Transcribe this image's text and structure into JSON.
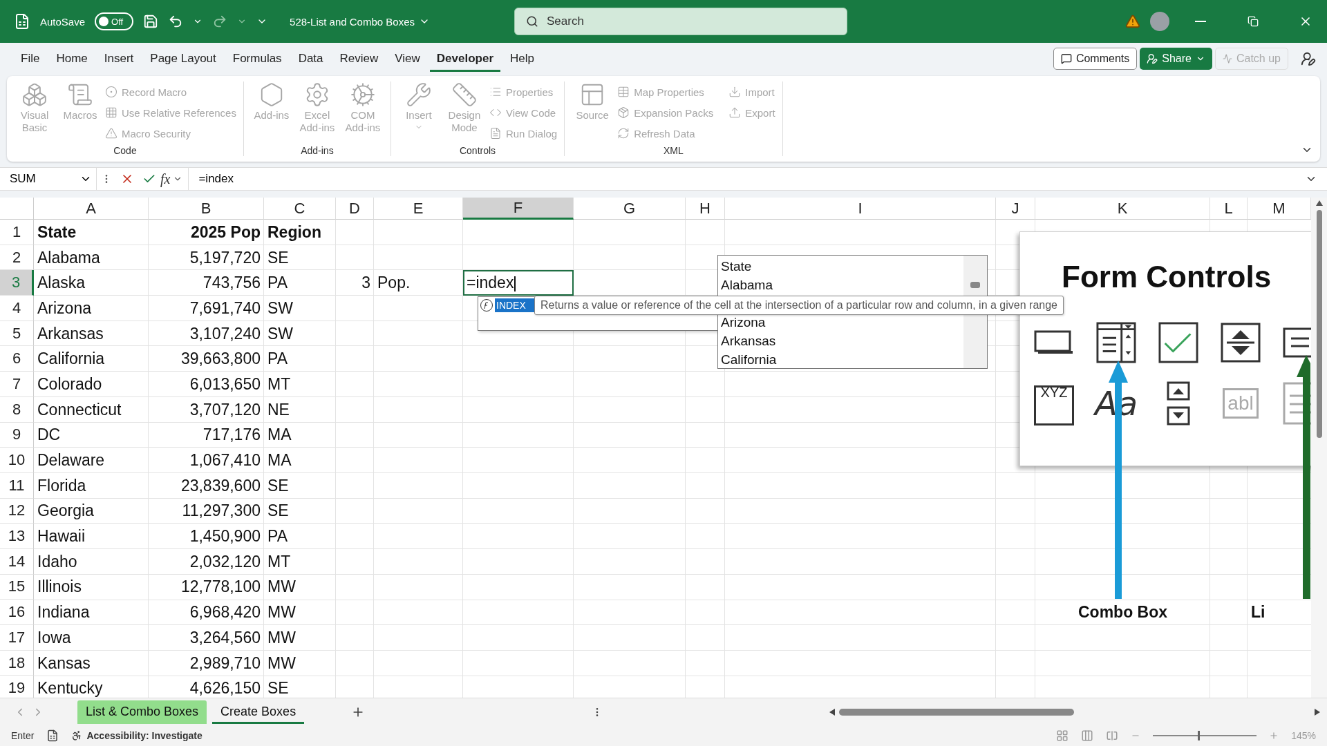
{
  "title_bar": {
    "autosave_label": "AutoSave",
    "autosave_on": false,
    "autosave_state": "Off",
    "file_name": "528-List and Combo Boxes",
    "search_placeholder": "Search"
  },
  "menu_tabs": [
    {
      "label": "File",
      "selected": false
    },
    {
      "label": "Home",
      "selected": false
    },
    {
      "label": "Insert",
      "selected": false
    },
    {
      "label": "Page Layout",
      "selected": false
    },
    {
      "label": "Formulas",
      "selected": false
    },
    {
      "label": "Data",
      "selected": false
    },
    {
      "label": "Review",
      "selected": false
    },
    {
      "label": "View",
      "selected": false
    },
    {
      "label": "Developer",
      "selected": true
    },
    {
      "label": "Help",
      "selected": false
    }
  ],
  "header_buttons": {
    "comments": "Comments",
    "share": "Share",
    "catch_up": "Catch up"
  },
  "ribbon_groups": [
    {
      "label": "Code",
      "items": [
        {
          "kind": "large",
          "label": "Visual Basic",
          "disabled": true
        },
        {
          "kind": "large",
          "label": "Macros",
          "disabled": true
        },
        {
          "kind": "small",
          "label": "Record Macro",
          "disabled": true
        },
        {
          "kind": "small",
          "label": "Use Relative References",
          "disabled": true
        },
        {
          "kind": "small",
          "label": "Macro Security",
          "disabled": true
        }
      ]
    },
    {
      "label": "Add-ins",
      "items": [
        {
          "kind": "large",
          "label": "Add-ins",
          "disabled": true
        },
        {
          "kind": "large",
          "label": "Excel Add-ins",
          "disabled": true
        },
        {
          "kind": "large",
          "label": "COM Add-ins",
          "disabled": true
        }
      ]
    },
    {
      "label": "Controls",
      "items": [
        {
          "kind": "large",
          "label": "Insert",
          "disabled": true,
          "dropdown": true
        },
        {
          "kind": "large",
          "label": "Design Mode",
          "disabled": true
        },
        {
          "kind": "small",
          "label": "Properties",
          "disabled": true
        },
        {
          "kind": "small",
          "label": "View Code",
          "disabled": true
        },
        {
          "kind": "small",
          "label": "Run Dialog",
          "disabled": true
        }
      ]
    },
    {
      "label": "XML",
      "items": [
        {
          "kind": "large",
          "label": "Source",
          "disabled": true
        },
        {
          "kind": "small",
          "label": "Map Properties",
          "disabled": true
        },
        {
          "kind": "small",
          "label": "Expansion Packs",
          "disabled": true
        },
        {
          "kind": "small",
          "label": "Refresh Data",
          "disabled": true
        },
        {
          "kind": "small",
          "label": "Import",
          "disabled": true
        },
        {
          "kind": "small",
          "label": "Export",
          "disabled": true
        }
      ]
    }
  ],
  "formula_bar": {
    "name_box": "SUM",
    "function_label": "fx",
    "formula": "=index"
  },
  "columns": [
    {
      "label": "A",
      "selected": false
    },
    {
      "label": "B",
      "selected": false
    },
    {
      "label": "C",
      "selected": false
    },
    {
      "label": "D",
      "selected": false
    },
    {
      "label": "E",
      "selected": false
    },
    {
      "label": "F",
      "selected": true
    },
    {
      "label": "G",
      "selected": false
    },
    {
      "label": "H",
      "selected": false
    },
    {
      "label": "I",
      "selected": false
    },
    {
      "label": "J",
      "selected": false
    },
    {
      "label": "K",
      "selected": false
    },
    {
      "label": "L",
      "selected": false
    },
    {
      "label": "M",
      "selected": false
    }
  ],
  "rows": [
    {
      "number": "1",
      "selected": false,
      "cells": [
        {
          "text": "State",
          "bold": true
        },
        {
          "text": "2025 Pop",
          "bold": true
        },
        {
          "text": "Region",
          "bold": true
        }
      ]
    },
    {
      "number": "2",
      "selected": false,
      "cells": [
        "Alabama",
        "5,197,720",
        "SE"
      ]
    },
    {
      "number": "3",
      "selected": true,
      "cells": [
        "Alaska",
        "743,756",
        "PA",
        "3",
        "Pop.",
        {
          "text": "=index",
          "editing": true
        }
      ]
    },
    {
      "number": "4",
      "selected": false,
      "cells": [
        "Arizona",
        "7,691,740",
        "SW"
      ]
    },
    {
      "number": "5",
      "selected": false,
      "cells": [
        "Arkansas",
        "3,107,240",
        "SW"
      ]
    },
    {
      "number": "6",
      "selected": false,
      "cells": [
        "California",
        "39,663,800",
        "PA"
      ]
    },
    {
      "number": "7",
      "selected": false,
      "cells": [
        "Colorado",
        "6,013,650",
        "MT"
      ]
    },
    {
      "number": "8",
      "selected": false,
      "cells": [
        "Connecticut",
        "3,707,120",
        "NE"
      ]
    },
    {
      "number": "9",
      "selected": false,
      "cells": [
        "DC",
        "717,176",
        "MA"
      ]
    },
    {
      "number": "10",
      "selected": false,
      "cells": [
        "Delaware",
        "1,067,410",
        "MA"
      ]
    },
    {
      "number": "11",
      "selected": false,
      "cells": [
        "Florida",
        "23,839,600",
        "SE"
      ]
    },
    {
      "number": "12",
      "selected": false,
      "cells": [
        "Georgia",
        "11,297,300",
        "SE"
      ]
    },
    {
      "number": "13",
      "selected": false,
      "cells": [
        "Hawaii",
        "1,450,900",
        "PA"
      ]
    },
    {
      "number": "14",
      "selected": false,
      "cells": [
        "Idaho",
        "2,032,120",
        "MT"
      ]
    },
    {
      "number": "15",
      "selected": false,
      "cells": [
        "Illinois",
        "12,778,100",
        "MW"
      ]
    },
    {
      "number": "16",
      "selected": false,
      "cells": [
        "Indiana",
        "6,968,420",
        "MW",
        null,
        null,
        null,
        null,
        null,
        null,
        null,
        {
          "text": "Combo Box",
          "bold": true
        },
        null,
        {
          "text": "Li",
          "bold": true
        }
      ]
    },
    {
      "number": "17",
      "selected": false,
      "cells": [
        "Iowa",
        "3,264,560",
        "MW"
      ]
    },
    {
      "number": "18",
      "selected": false,
      "cells": [
        "Kansas",
        "2,989,710",
        "MW"
      ]
    },
    {
      "number": "19",
      "selected": false,
      "cells": [
        "Kentucky",
        "4,626,150",
        "SE"
      ]
    }
  ],
  "autocomplete": {
    "items": [
      {
        "label": "INDEX",
        "selected": true
      }
    ],
    "tooltip": "Returns a value or reference of the cell at the intersection of a particular row and column, in a given range"
  },
  "list_box": {
    "items": [
      "State",
      "Alabama",
      "Arizona",
      "Arkansas",
      "California"
    ]
  },
  "form_controls_picture": {
    "title": "Form Controls",
    "controls": [
      {
        "kind": "button"
      },
      {
        "kind": "combo"
      },
      {
        "kind": "checkbox"
      },
      {
        "kind": "spin"
      },
      {
        "kind": "list"
      },
      {
        "kind": "group",
        "glyph": "XYZ"
      },
      {
        "kind": "label",
        "glyph": "Aa"
      },
      {
        "kind": "scrollbar"
      },
      {
        "kind": "textfield",
        "glyph": "abl",
        "disabled": true
      },
      {
        "kind": "combolist",
        "disabled": true
      }
    ]
  },
  "sheet_tabs": [
    {
      "label": "List & Combo Boxes",
      "selected": false,
      "color": "#92dd8c"
    },
    {
      "label": "Create Boxes",
      "selected": true
    }
  ],
  "status_bar": {
    "mode": "Enter",
    "accessibility": "Accessibility: Investigate",
    "zoom_slider": {
      "level": 0.45
    },
    "zoom": "145%"
  }
}
